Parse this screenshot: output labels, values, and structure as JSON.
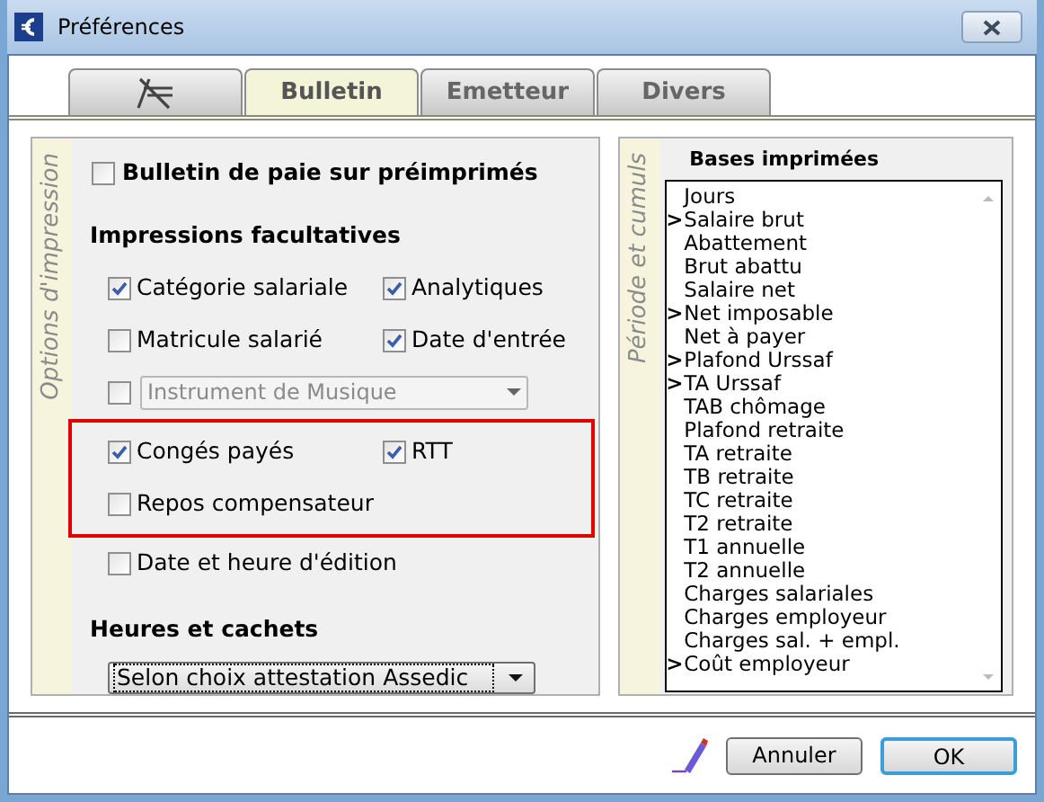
{
  "window": {
    "title": "Préférences"
  },
  "tabs": [
    {
      "kind": "icon",
      "selected": false
    },
    {
      "kind": "text",
      "label": "Bulletin",
      "selected": true
    },
    {
      "kind": "text",
      "label": "Emetteur",
      "selected": false
    },
    {
      "kind": "text",
      "label": "Divers",
      "selected": false
    }
  ],
  "options_panel": {
    "side_label": "Options d'impression",
    "preprinted": {
      "label": "Bulletin de paie sur préimprimés",
      "checked": false
    },
    "optional_title": "Impressions facultatives",
    "groups": [
      {
        "highlighted": false,
        "rows": [
          {
            "kind": "checks",
            "items": [
              {
                "label": "Catégorie salariale",
                "checked": true
              },
              {
                "label": "Analytiques",
                "checked": true
              }
            ]
          },
          {
            "kind": "checks",
            "items": [
              {
                "label": "Matricule salarié",
                "checked": false
              },
              {
                "label": "Date d'entrée",
                "checked": true
              }
            ]
          },
          {
            "kind": "select",
            "checked": false,
            "value": "Instrument de Musique",
            "disabled": true
          }
        ]
      },
      {
        "highlighted": true,
        "rows": [
          {
            "kind": "checks",
            "items": [
              {
                "label": "Congés payés",
                "checked": true
              },
              {
                "label": "RTT",
                "checked": true
              }
            ]
          },
          {
            "kind": "checks",
            "items": [
              {
                "label": "Repos compensateur",
                "checked": false
              }
            ]
          }
        ]
      },
      {
        "highlighted": false,
        "rows": [
          {
            "kind": "checks",
            "items": [
              {
                "label": "Date et heure d'édition",
                "checked": false
              }
            ]
          }
        ]
      }
    ],
    "hours": {
      "title": "Heures et cachets",
      "value": "Selon choix attestation Assedic"
    }
  },
  "cumuls_panel": {
    "side_label": "Période et cumuls",
    "list_title": "Bases imprimées",
    "items": [
      {
        "label": "Jours"
      },
      {
        "label": "Salaire brut",
        "marker": ">"
      },
      {
        "label": "Abattement"
      },
      {
        "label": "Brut abattu"
      },
      {
        "label": "Salaire net"
      },
      {
        "label": "Net imposable",
        "marker": ">"
      },
      {
        "label": "Net à payer"
      },
      {
        "label": "Plafond Urssaf",
        "marker": ">"
      },
      {
        "label": "TA Urssaf",
        "marker": ">"
      },
      {
        "label": "TAB chômage"
      },
      {
        "label": "Plafond retraite"
      },
      {
        "label": "TA retraite"
      },
      {
        "label": "TB retraite"
      },
      {
        "label": "TC retraite"
      },
      {
        "label": "T2 retraite"
      },
      {
        "label": "T1 annuelle"
      },
      {
        "label": "T2 annuelle"
      },
      {
        "label": "Charges salariales"
      },
      {
        "label": "Charges employeur"
      },
      {
        "label": "Charges sal. + empl."
      },
      {
        "label": "Coût employeur",
        "marker": ">"
      }
    ]
  },
  "buttons": [
    {
      "label": "Annuler",
      "default": false
    },
    {
      "label": "OK",
      "default": true
    }
  ]
}
